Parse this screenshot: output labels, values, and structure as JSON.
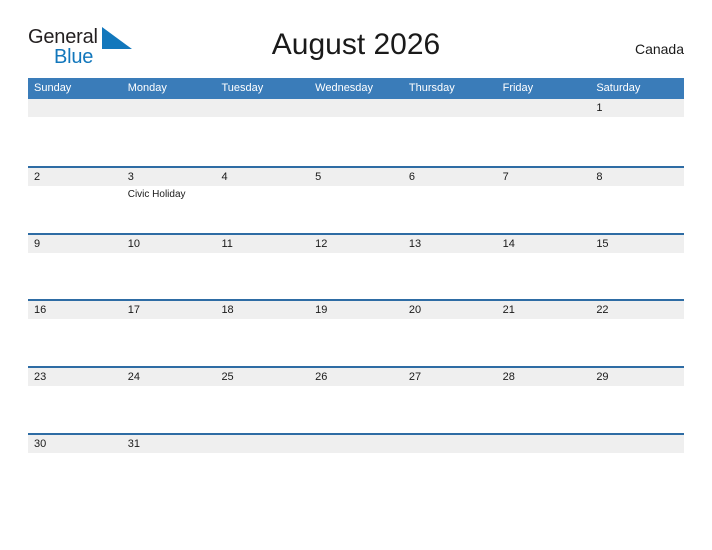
{
  "brand": {
    "name_part1": "General",
    "name_part2": "Blue",
    "color_dark": "#231f20",
    "color_blue": "#1277bc"
  },
  "header": {
    "title": "August 2026",
    "country": "Canada"
  },
  "calendar": {
    "accent_header_color": "#3a7cb9",
    "row_border_color": "#2e6ca4",
    "band_color": "#efefef",
    "weekdays": [
      "Sunday",
      "Monday",
      "Tuesday",
      "Wednesday",
      "Thursday",
      "Friday",
      "Saturday"
    ],
    "weeks": [
      [
        {
          "num": "",
          "events": []
        },
        {
          "num": "",
          "events": []
        },
        {
          "num": "",
          "events": []
        },
        {
          "num": "",
          "events": []
        },
        {
          "num": "",
          "events": []
        },
        {
          "num": "",
          "events": []
        },
        {
          "num": "1",
          "events": []
        }
      ],
      [
        {
          "num": "2",
          "events": []
        },
        {
          "num": "3",
          "events": [
            "Civic Holiday"
          ]
        },
        {
          "num": "4",
          "events": []
        },
        {
          "num": "5",
          "events": []
        },
        {
          "num": "6",
          "events": []
        },
        {
          "num": "7",
          "events": []
        },
        {
          "num": "8",
          "events": []
        }
      ],
      [
        {
          "num": "9",
          "events": []
        },
        {
          "num": "10",
          "events": []
        },
        {
          "num": "11",
          "events": []
        },
        {
          "num": "12",
          "events": []
        },
        {
          "num": "13",
          "events": []
        },
        {
          "num": "14",
          "events": []
        },
        {
          "num": "15",
          "events": []
        }
      ],
      [
        {
          "num": "16",
          "events": []
        },
        {
          "num": "17",
          "events": []
        },
        {
          "num": "18",
          "events": []
        },
        {
          "num": "19",
          "events": []
        },
        {
          "num": "20",
          "events": []
        },
        {
          "num": "21",
          "events": []
        },
        {
          "num": "22",
          "events": []
        }
      ],
      [
        {
          "num": "23",
          "events": []
        },
        {
          "num": "24",
          "events": []
        },
        {
          "num": "25",
          "events": []
        },
        {
          "num": "26",
          "events": []
        },
        {
          "num": "27",
          "events": []
        },
        {
          "num": "28",
          "events": []
        },
        {
          "num": "29",
          "events": []
        }
      ],
      [
        {
          "num": "30",
          "events": []
        },
        {
          "num": "31",
          "events": []
        },
        {
          "num": "",
          "events": []
        },
        {
          "num": "",
          "events": []
        },
        {
          "num": "",
          "events": []
        },
        {
          "num": "",
          "events": []
        },
        {
          "num": "",
          "events": []
        }
      ]
    ]
  }
}
